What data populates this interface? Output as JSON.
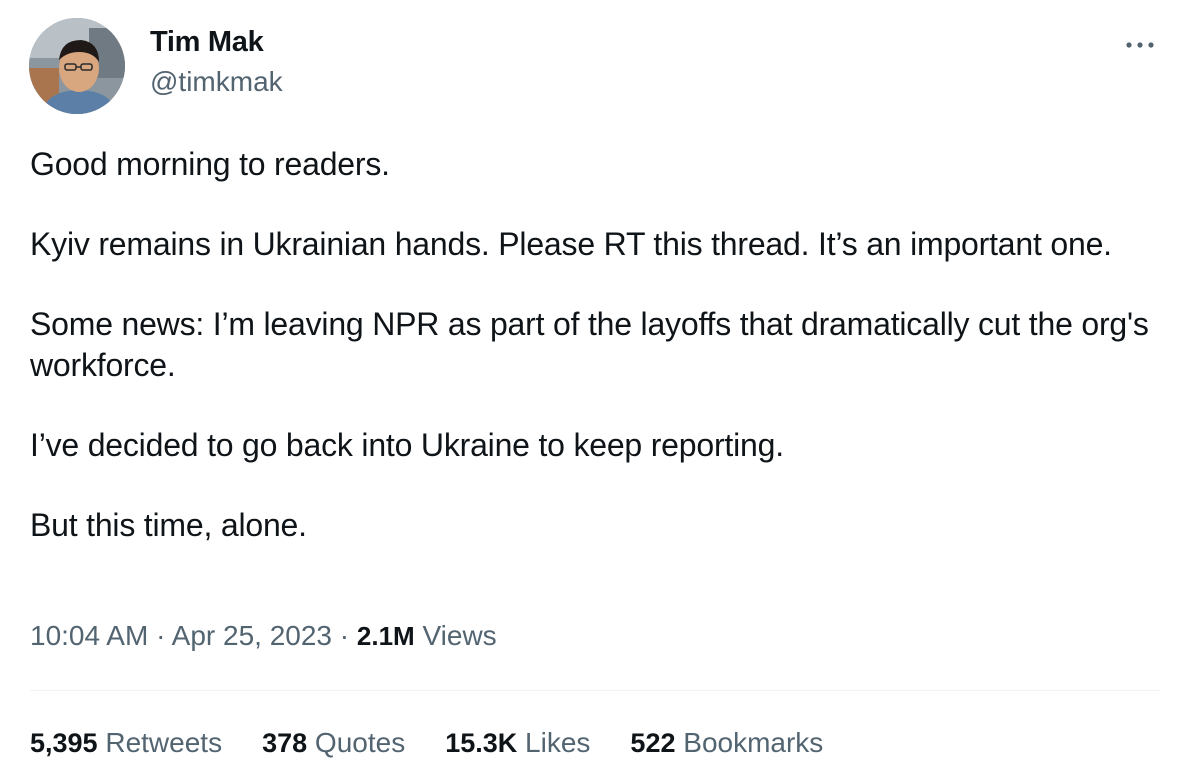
{
  "author": {
    "name": "Tim Mak",
    "handle": "@timkmak"
  },
  "more_icon": "more-horizontal-icon",
  "body": {
    "paragraphs": [
      "Good morning to readers.",
      "Kyiv remains in Ukrainian hands. Please RT this thread. It’s an important one.",
      "Some news: I’m leaving NPR as part of the layoffs that dramatically cut the org's workforce.",
      "I’ve decided to go back into Ukraine to keep reporting.",
      "But this time, alone."
    ]
  },
  "meta": {
    "time": "10:04 AM",
    "separator": "·",
    "date": "Apr 25, 2023",
    "views_count": "2.1M",
    "views_label": "Views"
  },
  "stats": {
    "retweets": {
      "count": "5,395",
      "label": "Retweets"
    },
    "quotes": {
      "count": "378",
      "label": "Quotes"
    },
    "likes": {
      "count": "15.3K",
      "label": "Likes"
    },
    "bookmarks": {
      "count": "522",
      "label": "Bookmarks"
    }
  },
  "colors": {
    "text_primary": "#0f1419",
    "text_secondary": "#536471",
    "divider": "#eff3f4"
  }
}
